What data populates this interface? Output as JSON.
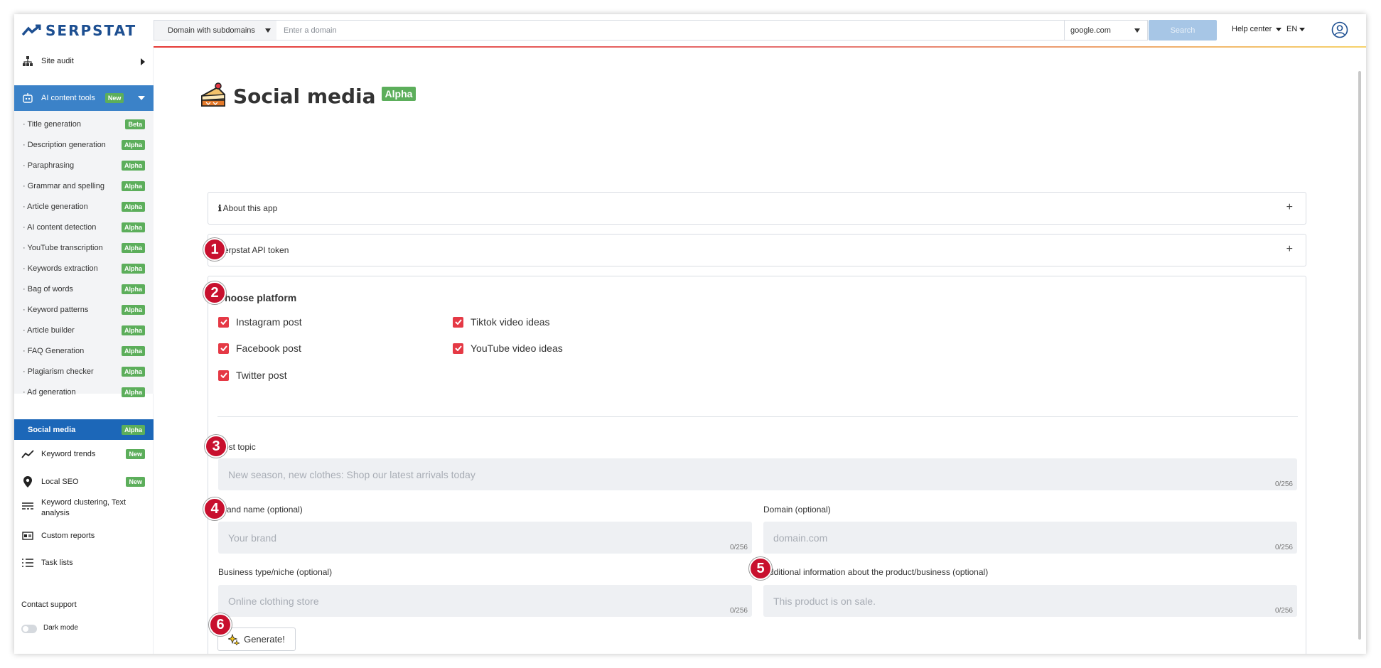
{
  "topbar": {
    "logo": "SERPSTAT",
    "domain_mode": "Domain with subdomains",
    "domain_placeholder": "Enter a domain",
    "search_engine": "google.com",
    "search_label": "Search",
    "help_label": "Help center",
    "lang_label": "EN"
  },
  "sidebar": {
    "site_audit": "Site audit",
    "ai_tools": "AI content tools",
    "ai_tools_badge": "New",
    "sub_items": [
      {
        "label": "Title generation",
        "badge": "Beta"
      },
      {
        "label": "Description generation",
        "badge": "Alpha"
      },
      {
        "label": "Paraphrasing",
        "badge": "Alpha"
      },
      {
        "label": "Grammar and spelling",
        "badge": "Alpha"
      },
      {
        "label": "Article generation",
        "badge": "Alpha"
      },
      {
        "label": "AI content detection",
        "badge": "Alpha"
      },
      {
        "label": "YouTube transcription",
        "badge": "Alpha"
      },
      {
        "label": "Keywords extraction",
        "badge": "Alpha"
      },
      {
        "label": "Bag of words",
        "badge": "Alpha"
      },
      {
        "label": "Keyword patterns",
        "badge": "Alpha"
      },
      {
        "label": "Article builder",
        "badge": "Alpha"
      },
      {
        "label": "FAQ Generation",
        "badge": "Alpha"
      },
      {
        "label": "Plagiarism checker",
        "badge": "Alpha"
      },
      {
        "label": "Ad generation",
        "badge": "Alpha"
      },
      {
        "label": "Social media",
        "badge": "Alpha"
      }
    ],
    "keyword_trends": "Keyword trends",
    "keyword_trends_badge": "New",
    "local_seo": "Local SEO",
    "local_seo_badge": "New",
    "clustering_line1": "Keyword clustering, Text",
    "clustering_line2": "analysis",
    "custom_reports": "Custom reports",
    "task_lists": "Task lists",
    "contact_support": "Contact support",
    "dark_mode": "Dark mode"
  },
  "main": {
    "title": "Social media",
    "title_badge": "Alpha",
    "about_label": "About this app",
    "about_prefix": "ℹ",
    "api_token_label": "Serpstat API token",
    "choose_platform": "Choose platform",
    "platforms": [
      "Instagram post",
      "Facebook post",
      "Twitter post",
      "Tiktok video ideas",
      "YouTube video ideas"
    ],
    "post_topic_label": "Post topic",
    "post_topic_placeholder": "New season, new clothes: Shop our latest arrivals today",
    "brand_label": "Brand name (optional)",
    "brand_placeholder": "Your brand",
    "domain_label": "Domain (optional)",
    "domain_placeholder": "domain.com",
    "business_label": "Business type/niche (optional)",
    "business_placeholder": "Online clothing store",
    "additional_label": "Additional information about the product/business (optional)",
    "additional_placeholder": "This product is on sale.",
    "counter": "0/256",
    "generate_label": "Generate!",
    "markers": [
      "1",
      "2",
      "3",
      "4",
      "5",
      "6"
    ]
  },
  "colors": {
    "accent": "#3b82c8",
    "active": "#1c67b8",
    "badge_green": "#5cae5b",
    "checkbox_red": "#e53945",
    "marker_red": "#c8102e"
  }
}
